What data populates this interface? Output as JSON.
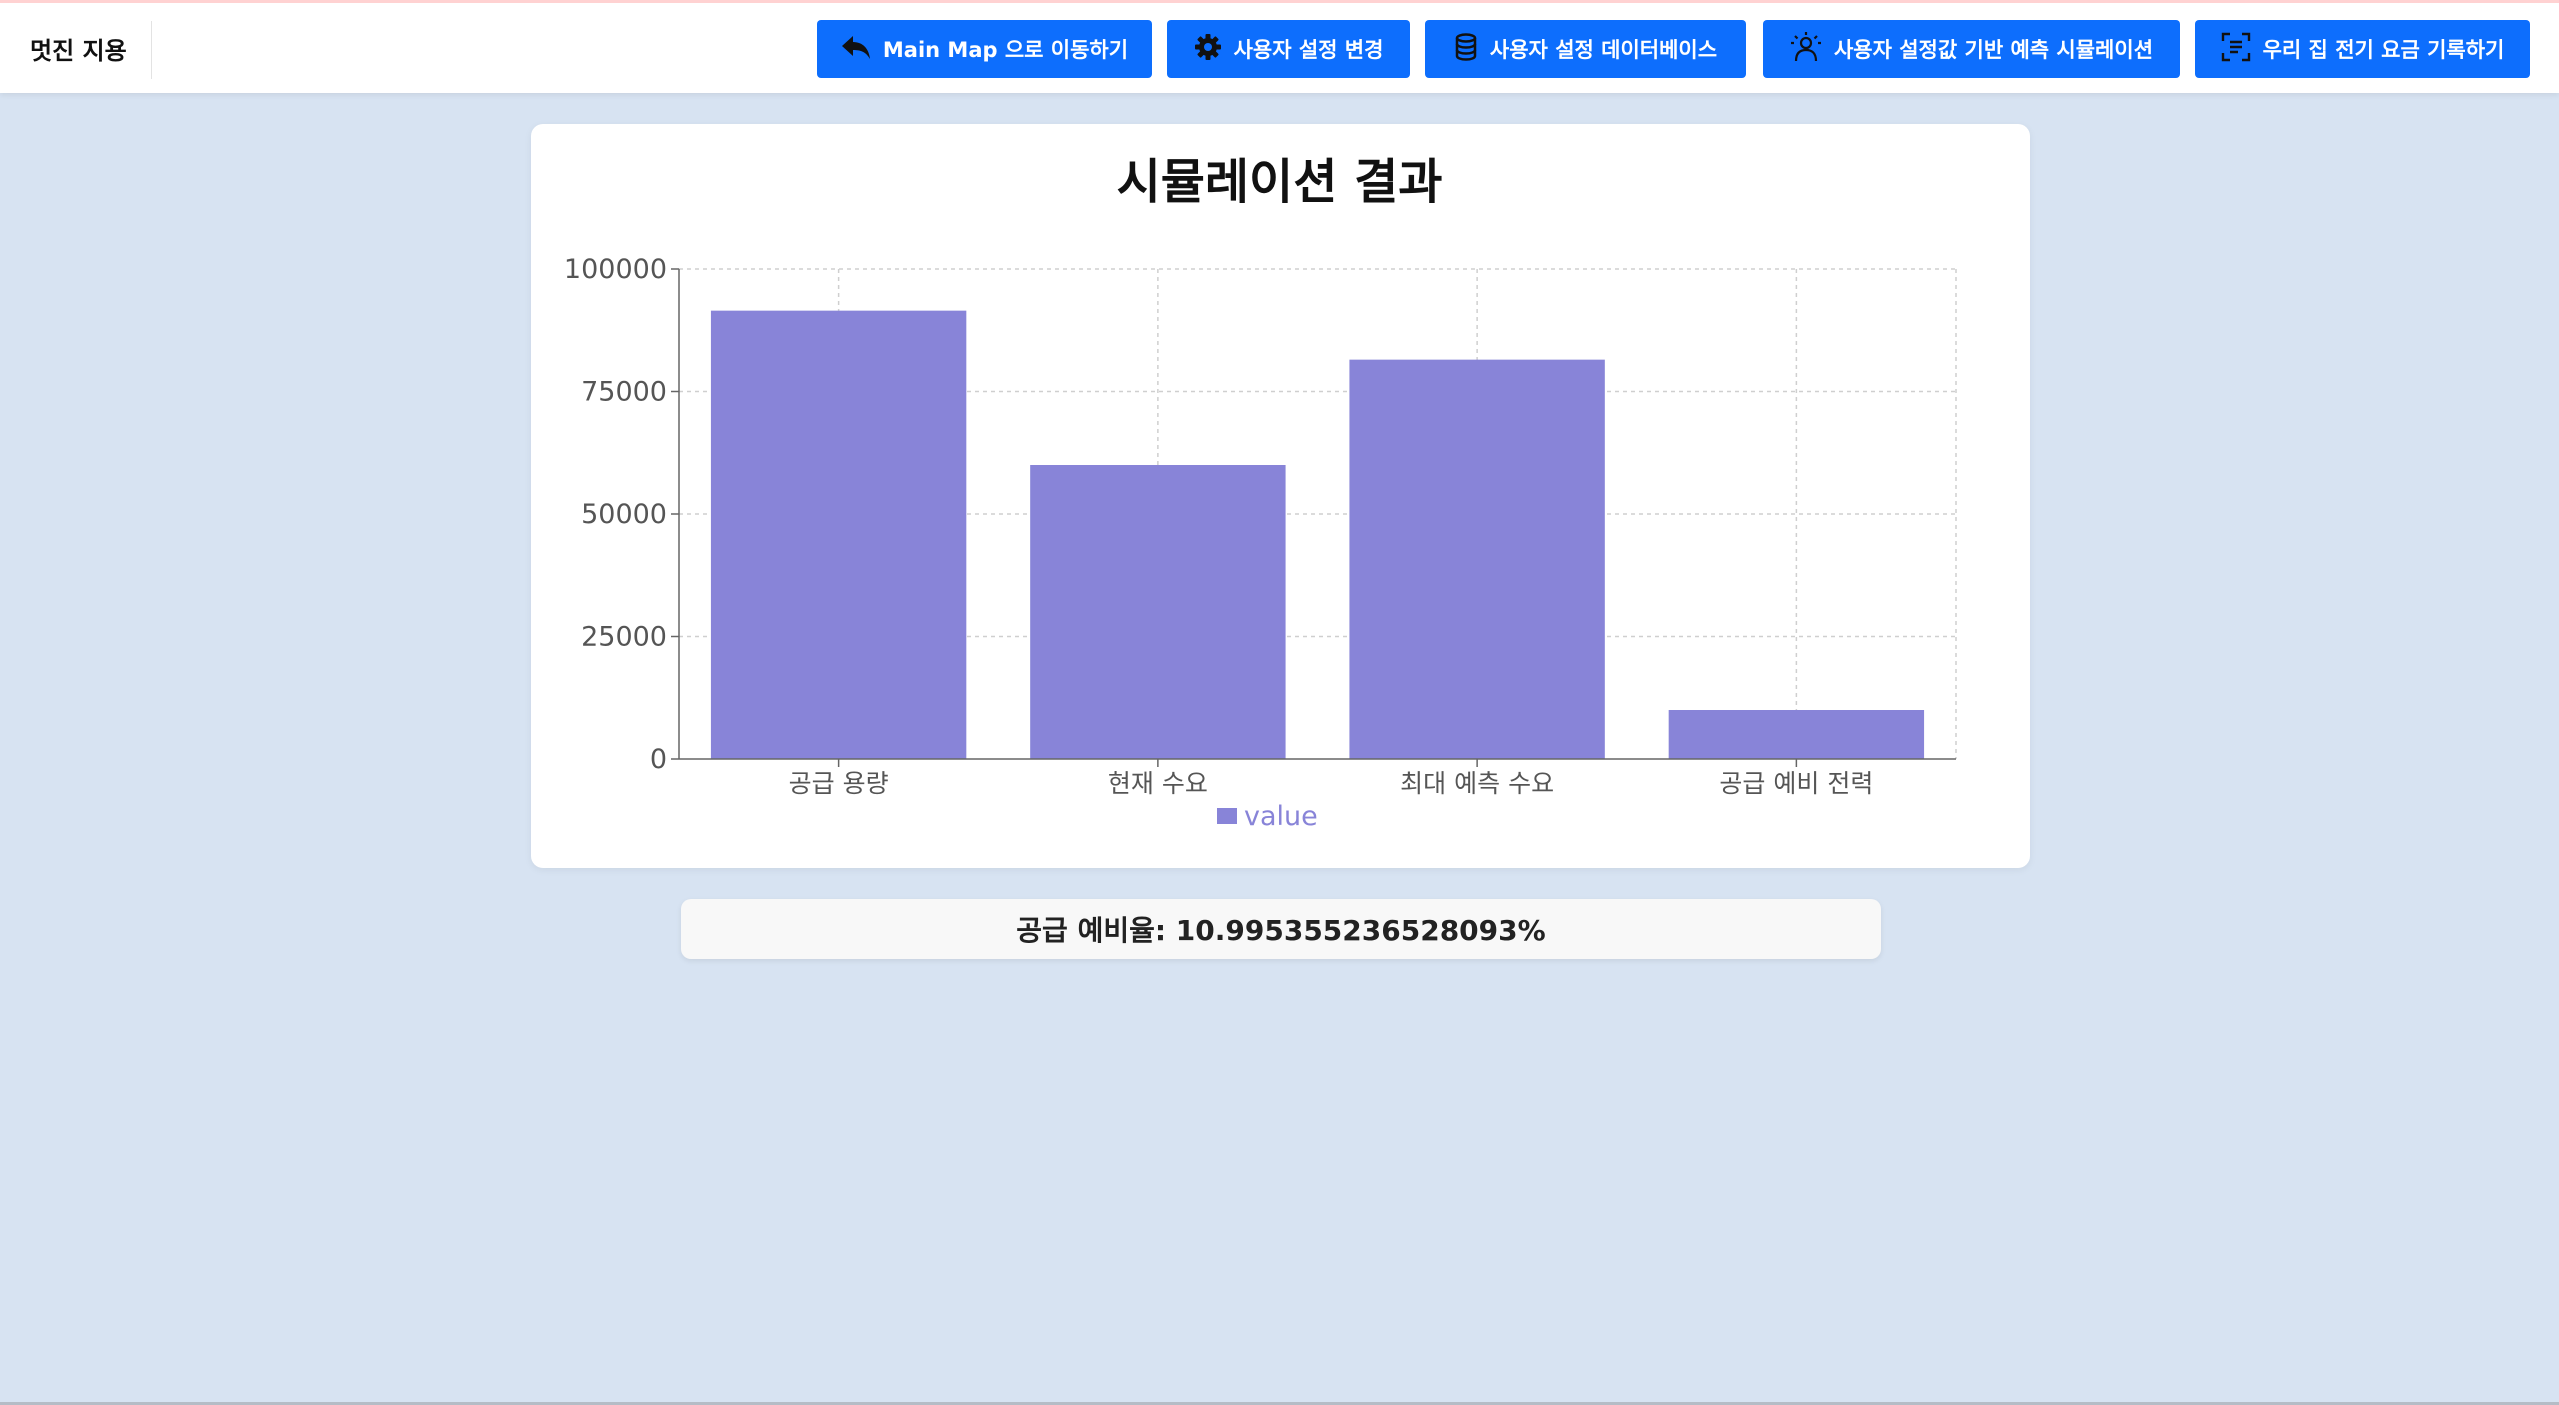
{
  "app": {
    "brand": "멋진 지용"
  },
  "nav": {
    "main_map": "Main Map 으로 이동하기",
    "settings": "사용자 설정 변경",
    "database": "사용자 설정 데이터베이스",
    "simulation": "사용자 설정값 기반 예측 시뮬레이션",
    "bill_record": "우리 집 전기 요금 기록하기"
  },
  "result": {
    "title": "시뮬레이션 결과",
    "ratio_text": "공급 예비율: 10.995355236528093%"
  },
  "colors": {
    "accent": "#0d6efd",
    "bar": "#8884d8",
    "background": "#d7e3f2"
  },
  "chart_data": {
    "type": "bar",
    "categories": [
      "공급 용량",
      "현재 수요",
      "최대 예측 수요",
      "공급 예비 전력"
    ],
    "series": [
      {
        "name": "value",
        "values": [
          91500,
          60000,
          81500,
          10000
        ]
      }
    ],
    "ylim": [
      0,
      100000
    ],
    "yticks": [
      "0",
      "25000",
      "50000",
      "75000",
      "100000"
    ],
    "grid": true,
    "legend": "bottom-center"
  }
}
